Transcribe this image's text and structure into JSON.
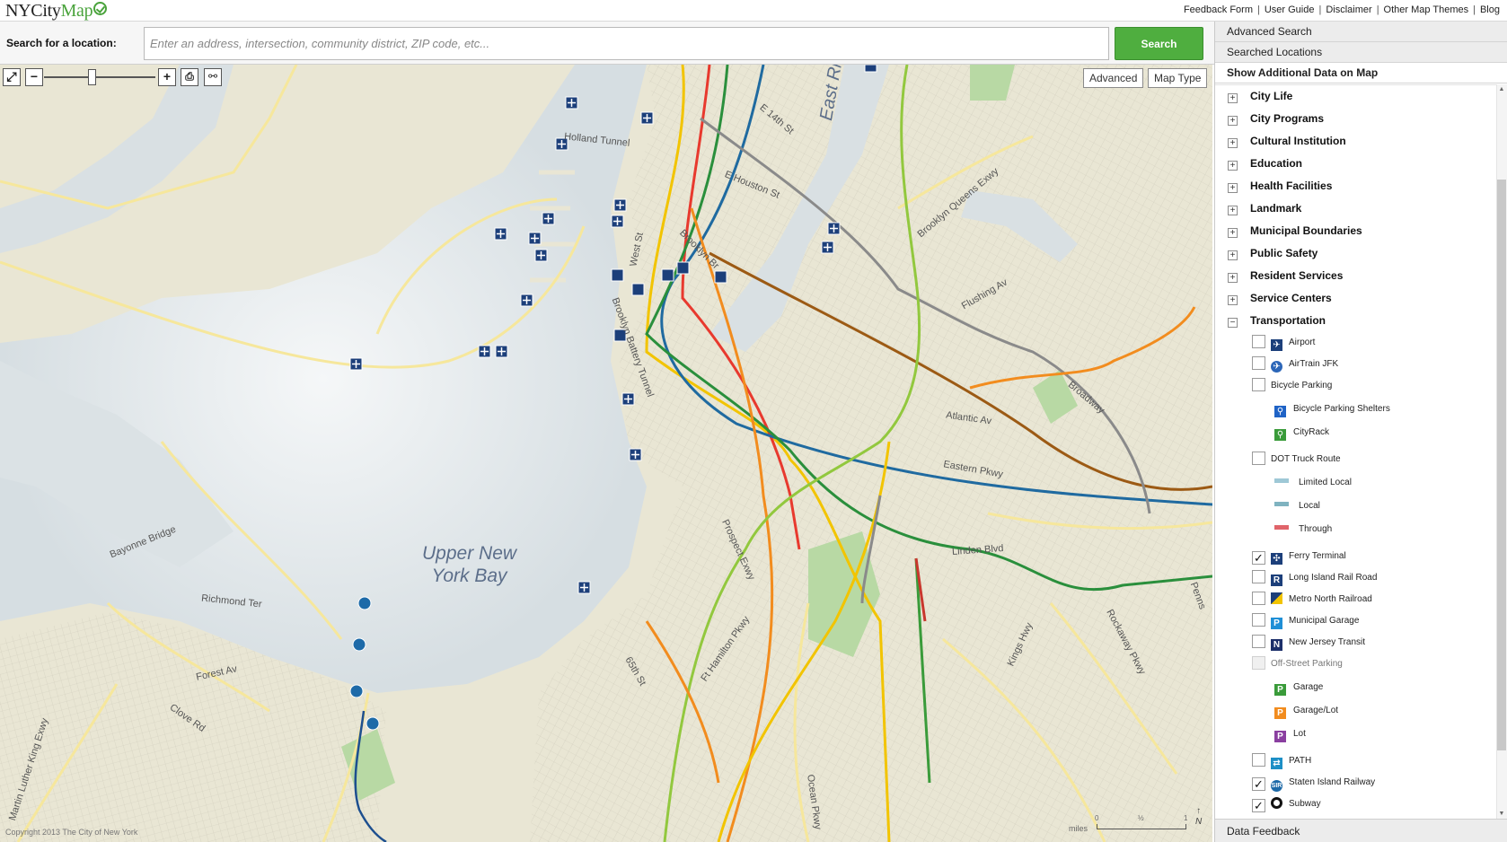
{
  "header": {
    "logo_ny": "NY",
    "logo_city": "City",
    "logo_map": "Map",
    "links": [
      "Feedback Form",
      "User Guide",
      "Disclaimer",
      "Other Map Themes",
      "Blog"
    ]
  },
  "search": {
    "label": "Search for a location:",
    "placeholder": "Enter an address, intersection, community district, ZIP code, etc...",
    "button": "Search"
  },
  "map": {
    "buttons": {
      "advanced": "Advanced",
      "map_type": "Map Type"
    },
    "water_labels": {
      "bay_line1": "Upper New",
      "bay_line2": "York Bay",
      "east_river": "East River"
    },
    "street_labels": [
      "Holland Tunnel",
      "E Houston St",
      "E 14th St",
      "West St",
      "Brooklyn Br",
      "Brooklyn Battery Tunnel",
      "Brooklyn Queens Exwy",
      "Flushing Av",
      "Broadway",
      "Atlantic Av",
      "Eastern Pkwy",
      "Linden Blvd",
      "Prospect Exwy",
      "Ft Hamilton Pkwy",
      "65th St",
      "Ocean Pkwy",
      "Kings Hwy",
      "Rockaway Pkwy",
      "Bayonne Bridge",
      "Richmond Ter",
      "Forest Av",
      "Clove Rd",
      "Martin Luther King Exwy",
      "Penns"
    ],
    "copyright": "Copyright 2013 The City of New York",
    "scale": {
      "unit": "miles",
      "ticks": [
        "0",
        "½",
        "1"
      ]
    },
    "north": "N"
  },
  "panel": {
    "advanced_search": "Advanced Search",
    "searched_locations": "Searched Locations",
    "show_data": "Show Additional Data on Map",
    "categories": [
      "City Life",
      "City Programs",
      "Cultural Institution",
      "Education",
      "Health Facilities",
      "Landmark",
      "Municipal Boundaries",
      "Public Safety",
      "Resident Services",
      "Service Centers",
      "Transportation"
    ],
    "transportation": {
      "airport": "Airport",
      "airtrain": "AirTrain JFK",
      "bicycle_parking": "Bicycle Parking",
      "bike_shelters": "Bicycle Parking Shelters",
      "cityrack": "CityRack",
      "dot_truck": "DOT Truck Route",
      "limited_local": "Limited Local",
      "local": "Local",
      "through": "Through",
      "ferry": "Ferry Terminal",
      "lirr": "Long Island Rail Road",
      "metro_north": "Metro North Railroad",
      "municipal_garage": "Municipal Garage",
      "nj_transit": "New Jersey Transit",
      "off_street": "Off-Street Parking",
      "garage": "Garage",
      "garage_lot": "Garage/Lot",
      "lot": "Lot",
      "path": "PATH",
      "sir": "Staten Island Railway",
      "subway": "Subway"
    },
    "checked": {
      "ferry": true,
      "sir": true,
      "subway": true
    },
    "data_feedback": "Data Feedback"
  },
  "colors": {
    "accent_green": "#4fae3f",
    "land": "#e9e6d4",
    "water": "#d9e0e3",
    "ferry_icon": "#1c3f7a",
    "truck_limited": "#9ec8d6",
    "truck_local": "#7fb3c0",
    "truck_through": "#e0646a"
  },
  "icons": [
    "maximize-icon",
    "zoom-out-icon",
    "zoom-in-icon",
    "print-icon",
    "link-icon",
    "ferry-icon",
    "airport-icon",
    "airtrain-icon",
    "bike-icon",
    "lirr-icon",
    "metro-north-icon",
    "parking-icon",
    "nj-transit-icon",
    "path-icon",
    "sir-icon",
    "subway-icon"
  ]
}
